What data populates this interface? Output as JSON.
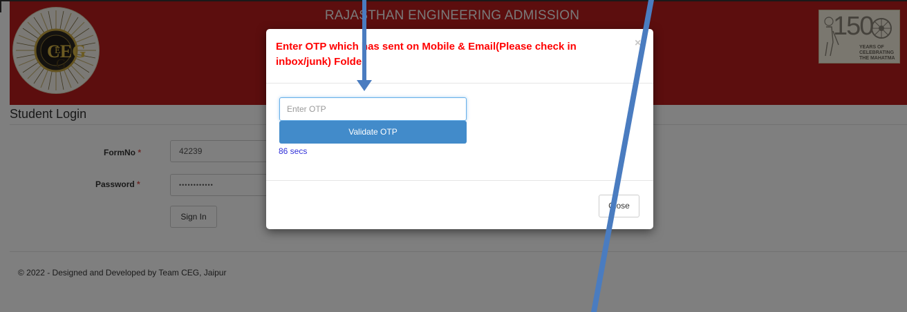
{
  "header": {
    "title": "RAJASTHAN ENGINEERING ADMISSION",
    "logo_text": "CEG",
    "badge": {
      "number": "150",
      "caption": "YEARS OF CELEBRATING THE MAHATMA",
      "line1": "YEARS OF",
      "line2": "CELEBRATING",
      "line3": "THE MAHATMA"
    }
  },
  "login": {
    "section_title": "Student Login",
    "formno_label": "FormNo",
    "formno_value": "42239",
    "password_label": "Password",
    "password_value": "••••••••••••",
    "required_mark": "*",
    "signin_label": "Sign In"
  },
  "footer": {
    "text": "© 2022 - Designed and Developed by Team CEG, Jaipur"
  },
  "modal": {
    "title": "Enter OTP which has sent on Mobile & Email(Please check in inbox/junk) Folder",
    "close_x": "×",
    "otp_placeholder": "Enter OTP",
    "validate_label": "Validate OTP",
    "timer": "86 secs",
    "close_label": "Close"
  },
  "colors": {
    "header_red": "#b81c1c",
    "modal_title_red": "#ff0000",
    "primary_blue": "#428bca",
    "annotation_arrow": "#4a7cc0"
  }
}
